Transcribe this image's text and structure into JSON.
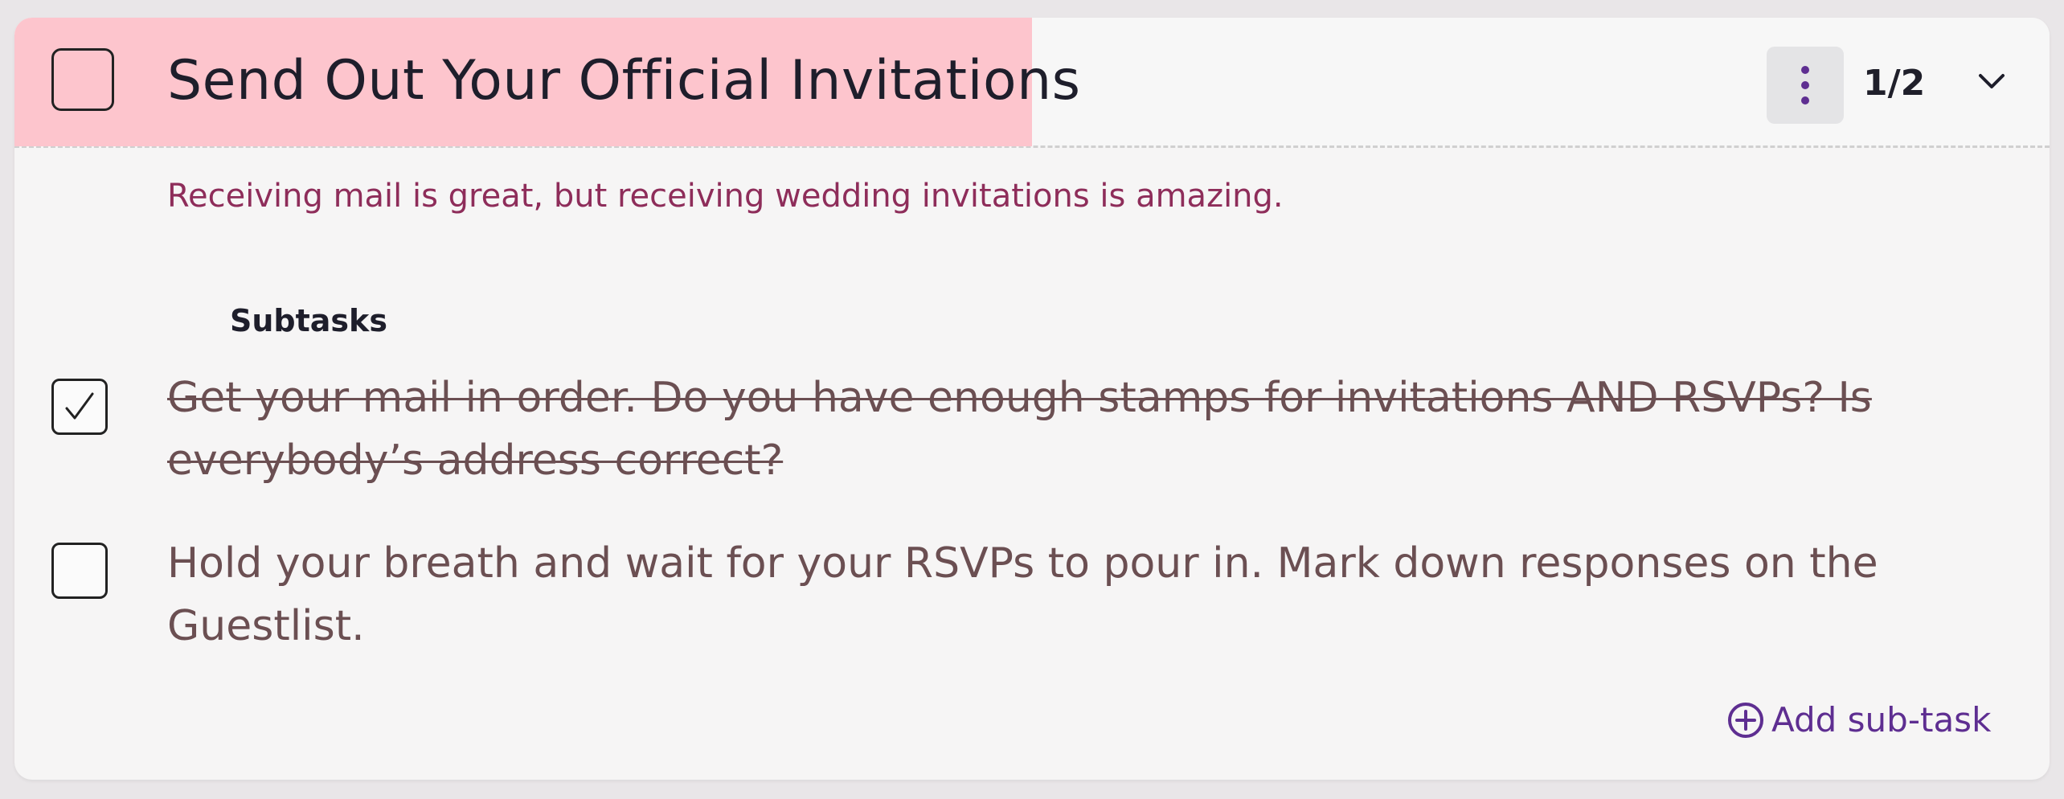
{
  "task": {
    "title": "Send Out Your Official Invitations",
    "progress": "1/2",
    "completed": false,
    "description": "Receiving mail is great, but receiving wedding invitations is amazing."
  },
  "icons": {
    "menu": "kebab-menu-icon",
    "expand": "chevron-down-icon",
    "check": "checkmark-icon",
    "add": "plus-circle-icon"
  },
  "subtasks": {
    "heading": "Subtasks",
    "items": [
      {
        "text": "Get your mail in order. Do you have enough stamps for invitations AND RSVPs? Is everybody’s address correct?",
        "done": true
      },
      {
        "text": "Hold your breath and wait for your RSVPs to pour in. Mark down responses on the Guestlist.",
        "done": false
      }
    ],
    "add_label": "Add sub-task"
  },
  "colors": {
    "title_band": "#fdc5cd",
    "description": "#8e2d5a",
    "accent": "#5e2e91",
    "subtask_text": "#6b4f52"
  }
}
